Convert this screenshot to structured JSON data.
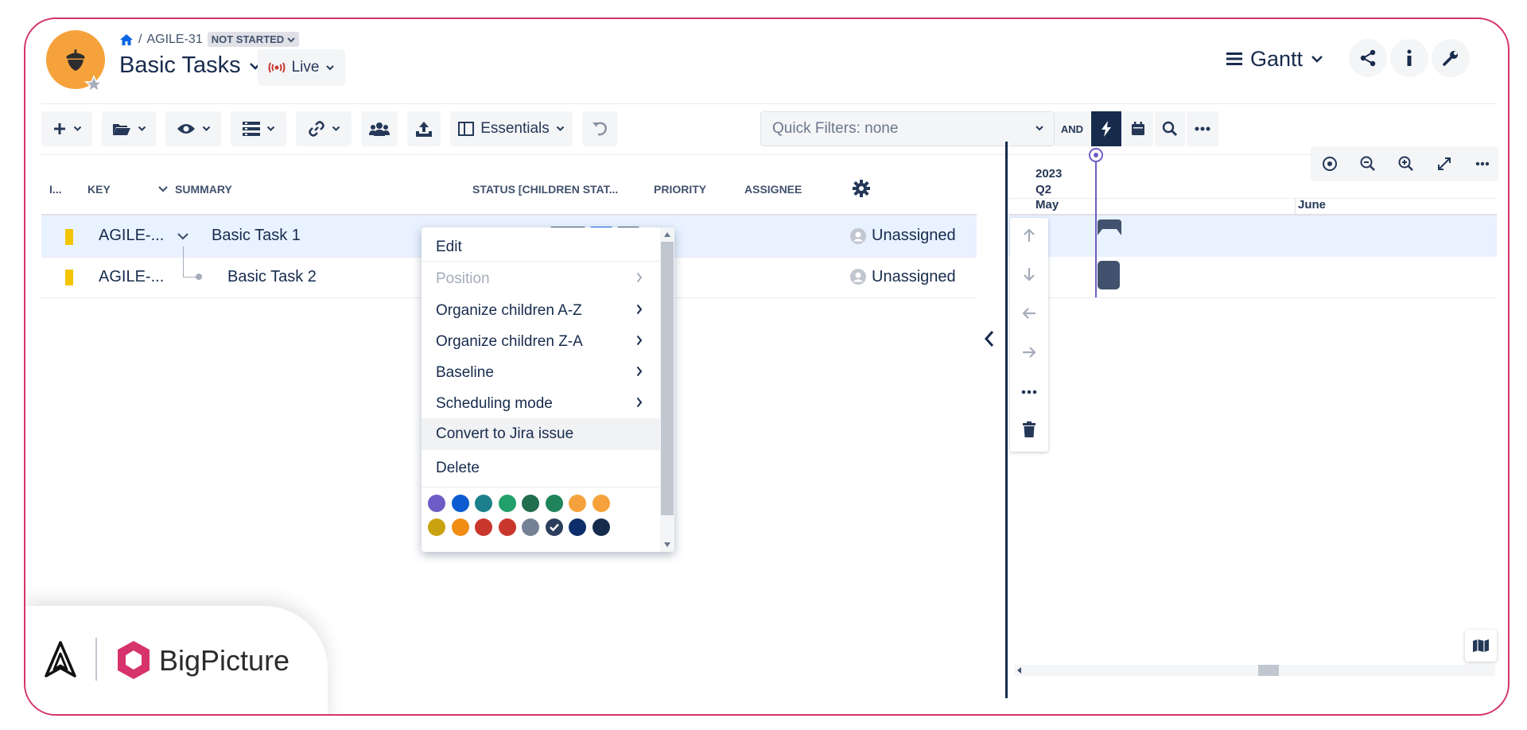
{
  "breadcrumb": {
    "issue_key": "AGILE-31",
    "status_badge": "NOT STARTED"
  },
  "header": {
    "title": "Basic Tasks",
    "live_label": "Live",
    "view_label": "Gantt"
  },
  "toolbar": {
    "view_preset": "Essentials",
    "quick_filters_placeholder": "Quick Filters: none",
    "and_label": "AND"
  },
  "columns": {
    "id": "I...",
    "key": "KEY",
    "summary": "SUMMARY",
    "status": "STATUS [CHILDREN STAT...",
    "priority": "PRIORITY",
    "assignee": "ASSIGNEE"
  },
  "rows": [
    {
      "key": "AGILE-...",
      "summary": "Basic Task 1",
      "assignee": "Unassigned",
      "selected": true
    },
    {
      "key": "AGILE-...",
      "summary": "Basic Task 2",
      "assignee": "Unassigned",
      "selected": false
    }
  ],
  "context_menu": {
    "items": [
      {
        "label": "Edit",
        "disabled": false,
        "submenu": false
      },
      {
        "label": "Position",
        "disabled": true,
        "submenu": true
      },
      {
        "label": "Organize children A-Z",
        "disabled": false,
        "submenu": true
      },
      {
        "label": "Organize children Z-A",
        "disabled": false,
        "submenu": true
      },
      {
        "label": "Baseline",
        "disabled": false,
        "submenu": true
      },
      {
        "label": "Scheduling mode",
        "disabled": false,
        "submenu": true
      },
      {
        "label": "Convert to Jira issue",
        "disabled": false,
        "submenu": false,
        "highlighted": true
      },
      {
        "label": "Delete",
        "disabled": false,
        "submenu": false
      }
    ],
    "colors_row1": [
      "#6e5dc6",
      "#0c5bd1",
      "#1d7f8c",
      "#22a06b",
      "#216e4e",
      "#1f845a",
      "#f5a23c",
      "#f5a23c"
    ],
    "colors_row2": [
      "#c9a20f",
      "#f18d13",
      "#c9372c",
      "#c9372c",
      "#758195",
      "#2c3e5d",
      "#0c2f6b",
      "#172b4d"
    ],
    "selected_color": "#2c3e5d"
  },
  "gantt": {
    "year": "2023",
    "quarter": "Q2",
    "months": [
      "May",
      "June"
    ]
  },
  "brand": {
    "name": "BigPicture"
  },
  "colors": {
    "accent": "#0c66e4",
    "selected_row": "#e9f2ff",
    "today_line": "#6e5dc6",
    "brand": "#d6336c"
  }
}
